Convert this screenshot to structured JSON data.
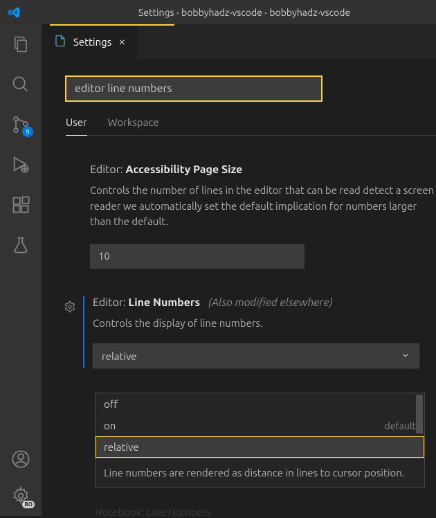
{
  "window": {
    "title": "Settings - bobbyhadz-vscode - bobbyhadz-vscode"
  },
  "activityBar": {
    "scmBadge": "9",
    "settingsBadge": "BO"
  },
  "tab": {
    "label": "Settings"
  },
  "search": {
    "value": "editor line numbers"
  },
  "scopes": {
    "user": "User",
    "workspace": "Workspace"
  },
  "settings": {
    "accessibility": {
      "prefix": "Editor: ",
      "name": "Accessibility Page Size",
      "description": "Controls the number of lines in the editor that can be read detect a screen reader we automatically set the default implication for numbers larger than the default.",
      "value": "10"
    },
    "lineNumbers": {
      "prefix": "Editor: ",
      "name": "Line Numbers",
      "modifiedNote": "(Also modified elsewhere)",
      "description": "Controls the display of line numbers.",
      "value": "relative",
      "options": {
        "off": "off",
        "on": "on",
        "onDefault": "default",
        "relative": "relative"
      },
      "selectedDescription": "Line numbers are rendered as distance in lines to cursor position."
    },
    "notebook": {
      "peek": "Notebook: Line Numbers"
    }
  }
}
